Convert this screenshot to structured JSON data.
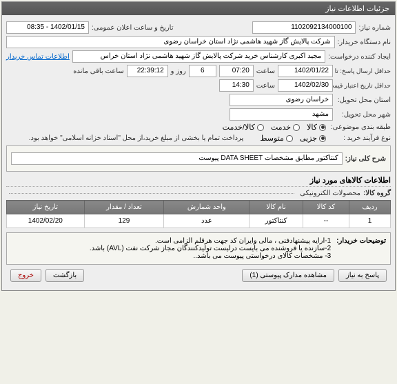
{
  "panel_title": "جزئیات اطلاعات نیاز",
  "fields": {
    "need_no_label": "شماره نیاز:",
    "need_no": "1102092134000100",
    "announce_date_label": "تاریخ و ساعت اعلان عمومی:",
    "announce_date": "1402/01/15 - 08:35",
    "buyer_org_label": "نام دستگاه خریدار:",
    "buyer_org": "شرکت پالایش گاز شهید هاشمی نژاد   استان خراسان رضوی",
    "creator_label": "ایجاد کننده درخواست:",
    "creator": "مجید اکبری کارشناس خرید شرکت پالایش گاز شهید هاشمی نژاد   استان خراس",
    "buyer_contact_link": "اطلاعات تماس خریدار",
    "deadline_label": "حداقل ارسال پاسخ: تا تاریخ:",
    "deadline_date": "1402/01/22",
    "time_label": "ساعت",
    "deadline_time": "07:20",
    "days_remaining": "6",
    "days_and_label": "روز و",
    "time_remaining": "22:39:12",
    "time_remaining_label": "ساعت باقی مانده",
    "validity_label": "حداقل تاریخ اعتبار قیمت: تا تاریخ:",
    "validity_date": "1402/02/30",
    "validity_time": "14:30",
    "province_label": "استان محل تحویل:",
    "province": "خراسان رضوی",
    "city_label": "شهر محل تحویل:",
    "city": "مشهد",
    "category_label": "طبقه بندی موضوعی:",
    "cat_goods": "کالا",
    "cat_service": "خدمت",
    "cat_goods_service": "کالا/خدمت",
    "process_label": "نوع فرآیند خرید :",
    "proc_partial": "جزیی",
    "proc_medium": "متوسط",
    "proc_note": "پرداخت تمام یا بخشی از مبلغ خرید،از محل \"اسناد خزانه اسلامی\" خواهد بود.",
    "desc_title_label": "شرح کلی نیاز:",
    "desc_title": "کنتاکتور مطابق مشخصات DATA SHEET پیوست",
    "items_section": "اطلاعات کالاهای مورد نیاز",
    "group_label": "گروه کالا:",
    "group_value": "محصولات الکترونیکی"
  },
  "table": {
    "headers": [
      "ردیف",
      "کد کالا",
      "نام کالا",
      "واحد شمارش",
      "تعداد / مقدار",
      "تاریخ نیاز"
    ],
    "rows": [
      {
        "idx": "1",
        "code": "--",
        "name": "کنتاکتور",
        "unit": "عدد",
        "qty": "129",
        "date": "1402/02/20"
      }
    ]
  },
  "buyer_desc": {
    "label": "توضیحات خریدار:",
    "line1": "1-ارایه پیشنهادفنی ، مالی وایران کد جهت هرقلم الزامی است.",
    "line2": "2-سازنده یا فروشنده می بایست درلیست تولیدکنندگان مجاز شرکت نفت (AVL)  باشد.",
    "line3": "3- مشخصات کالای درخواستی پیوست می باشد.."
  },
  "buttons": {
    "respond": "پاسخ به نیاز",
    "attachments": "مشاهده مدارک پیوستی (1)",
    "back": "بازگشت",
    "exit": "خروج"
  }
}
